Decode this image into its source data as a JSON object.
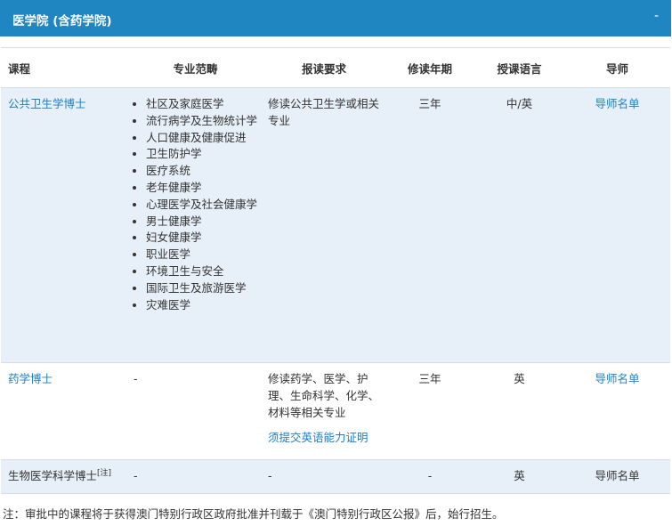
{
  "section": {
    "title": "医学院 (含药学院)",
    "collapse_symbol": "-"
  },
  "table": {
    "headers": {
      "course": "课程",
      "fields": "专业范畴",
      "requirements": "报读要求",
      "duration": "修读年期",
      "language": "授课语言",
      "supervisor": "导师"
    },
    "rows": [
      {
        "course": "公共卫生学博士",
        "fields": [
          "社区及家庭医学",
          "流行病学及生物统计学",
          "人口健康及健康促进",
          "卫生防护学",
          "医疗系统",
          "老年健康学",
          "心理医学及社会健康学",
          "男士健康学",
          "妇女健康学",
          "职业医学",
          "环境卫生与安全",
          "国际卫生及旅游医学",
          "灾难医学"
        ],
        "requirements": "修读公共卫生学或相关专业",
        "duration": "三年",
        "language": "中/英",
        "supervisor": "导师名单"
      },
      {
        "course": "药学博士",
        "fields": "-",
        "requirements": "修读药学、医学、护理、生命科学、化学、材料等相关专业",
        "requirements_note": "须提交英语能力证明",
        "duration": "三年",
        "language": "英",
        "supervisor": "导师名单"
      },
      {
        "course": "生物医学科学博士",
        "course_mark": "[注]",
        "fields": "-",
        "requirements": "-",
        "duration": "-",
        "language": "英",
        "supervisor": "导师名单"
      }
    ]
  },
  "footnote": "注：审批中的课程将于获得澳门特别行政区政府批准并刊载于《澳门特别行政区公报》后，始行招生。"
}
